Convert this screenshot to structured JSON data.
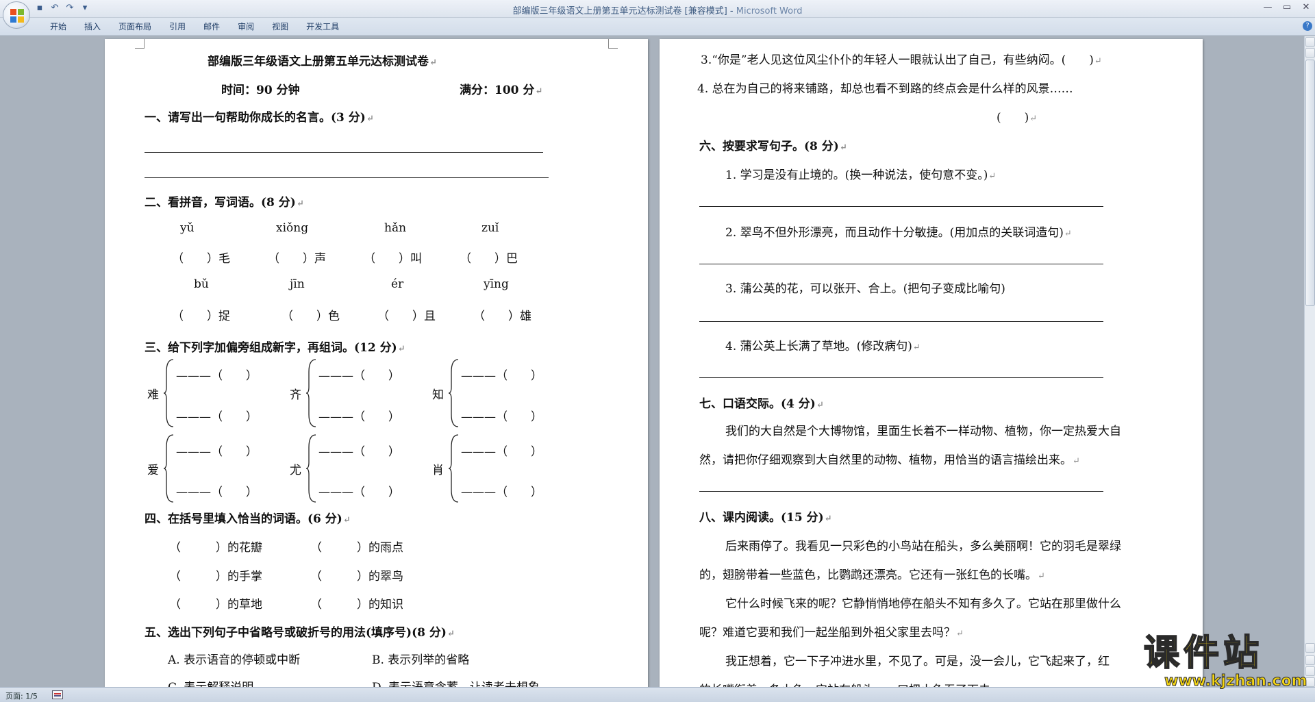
{
  "window": {
    "title": "部编版三年级语文上册第五单元达标测试卷 [兼容模式]",
    "app_name": "Microsoft Word",
    "separator": " - ",
    "controls": {
      "minimize": "—",
      "restore": "▭",
      "close": "✕"
    }
  },
  "quick_access": {
    "save": "▪",
    "undo": "↶",
    "redo": "↷",
    "customize": "▾"
  },
  "ribbon": {
    "tabs": [
      "开始",
      "插入",
      "页面布局",
      "引用",
      "邮件",
      "审阅",
      "视图",
      "开发工具"
    ],
    "help": "?"
  },
  "status": {
    "page": "页面: 1/5"
  },
  "watermark": {
    "top": "课件站",
    "bottom": "www.kjzhan.com"
  },
  "para_mark": "↵",
  "left_page": {
    "title": "部编版三年级语文上册第五单元达标测试卷",
    "time": "时间：90 分钟",
    "score": "满分：100 分",
    "s1": "一、请写出一句帮助你成长的名言。(3 分)",
    "s2": "二、看拼音，写词语。(8 分)",
    "pinyin_row1": [
      "yǔ",
      "xiǒng",
      "hǎn",
      "zuǐ"
    ],
    "words_row1": [
      "（　　）毛",
      "（　　）声",
      "（　　）叫",
      "（　　）巴"
    ],
    "pinyin_row2": [
      "bǔ",
      "jīn",
      "ér",
      "yīng"
    ],
    "words_row2": [
      "（　　）捉",
      "（　　）色",
      "（　　）且",
      "（　　）雄"
    ],
    "s3": "三、给下列字加偏旁组成新字，再组词。(12 分)",
    "radicals": [
      "难",
      "齐",
      "知",
      "爱",
      "尤",
      "肖"
    ],
    "blank": "———（　　）",
    "s4": "四、在括号里填入恰当的词语。(6 分)",
    "fill": [
      [
        "（　　　）的花瓣",
        "（　　　）的雨点"
      ],
      [
        "（　　　）的手掌",
        "（　　　）的翠鸟"
      ],
      [
        "（　　　）的草地",
        "（　　　）的知识"
      ]
    ],
    "s5": "五、选出下列句子中省略号或破折号的用法(填序号)(8 分)",
    "opt_a": "A. 表示语音的停顿或中断",
    "opt_b": "B. 表示列举的省略",
    "opt_c": "C. 表示解释说明",
    "opt_d": "D. 表示语意含蓄，让读者去想象"
  },
  "right_page": {
    "q3": "3.“你是”老人见这位风尘仆仆的年轻人一眼就认出了自己，有些纳闷。(　　)",
    "q4": "4. 总在为自己的将来铺路，却总也看不到路的终点会是什么样的风景……",
    "q4_paren": "(　　)",
    "s6": "六、按要求写句子。(8 分)",
    "s6_1": "1. 学习是没有止境的。(换一种说法，使句意不变。)",
    "s6_2": "2. 翠鸟不但外形漂亮，而且动作十分敏捷。(用加点的关联词造句)",
    "s6_3": "3. 蒲公英的花，可以张开、合上。(把句子变成比喻句)",
    "s6_4": "4. 蒲公英上长满了草地。(修改病句)",
    "s7": "七、口语交际。(4 分)",
    "s7_p1": "我们的大自然是个大博物馆，里面生长着不一样动物、植物，你一定热爱大自",
    "s7_p2": "然，请把你仔细观察到大自然里的动物、植物，用恰当的语言描绘出来。",
    "s8": "八、课内阅读。(15 分)",
    "r1": "后来雨停了。我看见一只彩色的小鸟站在船头，多么美丽啊！它的羽毛是翠绿",
    "r2": "的，翅膀带着一些蓝色，比鹦鹉还漂亮。它还有一张红色的长嘴。",
    "r3": "它什么时候飞来的呢？它静悄悄地停在船头不知有多久了。它站在那里做什么",
    "r4": "呢？难道它要和我们一起坐船到外祖父家里去吗？",
    "r5": "我正想着，它一下子冲进水里，不见了。可是，没一会儿，它飞起来了，红",
    "r6": "的长嘴衔着一条小鱼。它站在船头，一口把小鱼吞了下去。"
  },
  "colors": {
    "app_title": "#3d5a80",
    "workspace": "#a9b2bd",
    "watermark": "#f4d512"
  }
}
